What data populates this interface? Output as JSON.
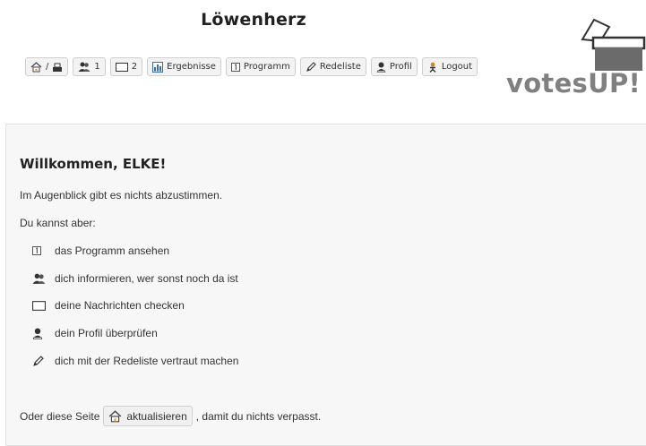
{
  "app": {
    "title": "Löwenherz"
  },
  "nav": {
    "home_sep": "/",
    "users_count": "1",
    "messages_count": "2",
    "results": "Ergebnisse",
    "program": "Programm",
    "speakers": "Redeliste",
    "profile": "Profil",
    "logout": "Logout"
  },
  "logo": {
    "text": "votesUP!"
  },
  "main": {
    "greeting": "Willkommen, ELKE!",
    "no_votes": "Im Augenblick gibt es nichts abzustimmen.",
    "can_do": "Du kannst aber:",
    "options": [
      {
        "icon": "program-icon",
        "label": "das Programm ansehen"
      },
      {
        "icon": "users-icon",
        "label": "dich informieren, wer sonst noch da ist"
      },
      {
        "icon": "envelope-icon",
        "label": "deine Nachrichten checken"
      },
      {
        "icon": "profile-icon",
        "label": "dein Profil überprüfen"
      },
      {
        "icon": "pen-icon",
        "label": "dich mit der Redeliste vertraut machen"
      }
    ],
    "refresh_prefix": "Oder diese Seite",
    "refresh_button": "aktualisieren",
    "refresh_suffix": ", damit du nichts verpasst."
  }
}
